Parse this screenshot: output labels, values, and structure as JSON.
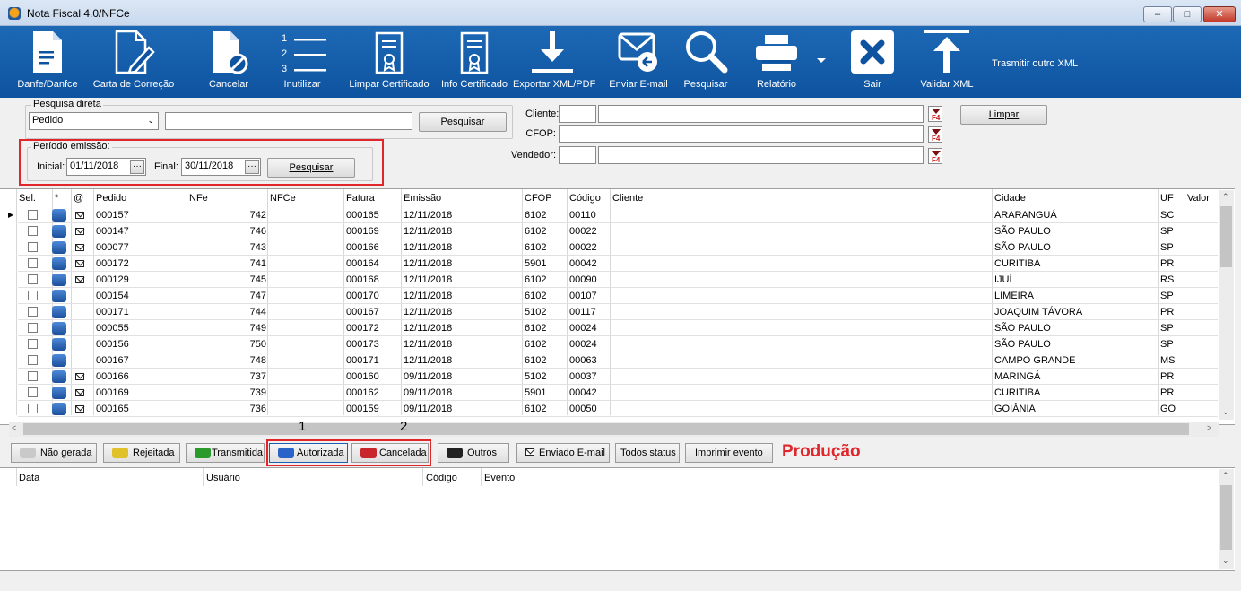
{
  "window": {
    "title": "Nota Fiscal 4.0/NFCe",
    "min_glyph": "–",
    "max_glyph": "□",
    "close_glyph": "✕"
  },
  "toolbar": {
    "items": [
      {
        "label": "Danfe/Danfce",
        "icon": "document-icon"
      },
      {
        "label": "Carta de Correção",
        "icon": "pencil-document-icon"
      },
      {
        "label": "Cancelar",
        "icon": "cancel-document-icon"
      },
      {
        "label": "Inutilizar",
        "icon": "numbered-list-icon"
      },
      {
        "label": "Limpar Certificado",
        "icon": "certificate-icon"
      },
      {
        "label": "Info Certificado",
        "icon": "certificate-info-icon"
      },
      {
        "label": "Exportar XML/PDF",
        "icon": "download-icon"
      },
      {
        "label": "Enviar E-mail",
        "icon": "mail-reply-icon"
      },
      {
        "label": "Pesquisar",
        "icon": "search-icon"
      },
      {
        "label": "Relatório",
        "icon": "printer-icon"
      },
      {
        "label": "Sair",
        "icon": "close-icon"
      },
      {
        "label": "Validar XML",
        "icon": "upload-arrow-icon"
      }
    ],
    "list_numbers": [
      "1",
      "2",
      "3"
    ],
    "transmit_other": "Trasmitir outro XML"
  },
  "search": {
    "group_title": "Pesquisa direta",
    "type_value": "Pedido",
    "text_value": "",
    "button": "Pesquisar"
  },
  "period": {
    "group_title": "Período emissão:",
    "start_label": "Inicial:",
    "start_value": "01/11/2018",
    "end_label": "Final:",
    "end_value": "30/11/2018",
    "button": "Pesquisar",
    "ellipsis": "···"
  },
  "filters": {
    "cliente_label": "Cliente:",
    "cfop_label": "CFOP:",
    "vendedor_label": "Vendedor:",
    "f4": "F4",
    "clear_button": "Limpar"
  },
  "grid": {
    "columns": [
      "Sel.",
      "*",
      "@",
      "Pedido",
      "NFe",
      "NFCe",
      "Fatura",
      "Emissão",
      "CFOP",
      "Código",
      "Cliente",
      "Cidade",
      "UF",
      "Valor"
    ],
    "current_row_marker": "▶",
    "rows": [
      {
        "pedido": "000157",
        "nfe": "742",
        "nfce": "",
        "fatura": "000165",
        "emissao": "12/11/2018",
        "cfop": "6102",
        "codigo": "00110",
        "cliente": "",
        "cidade": "ARARANGUÁ",
        "uf": "SC",
        "mail": true
      },
      {
        "pedido": "000147",
        "nfe": "746",
        "nfce": "",
        "fatura": "000169",
        "emissao": "12/11/2018",
        "cfop": "6102",
        "codigo": "00022",
        "cliente": "",
        "cidade": "SÃO PAULO",
        "uf": "SP",
        "mail": true
      },
      {
        "pedido": "000077",
        "nfe": "743",
        "nfce": "",
        "fatura": "000166",
        "emissao": "12/11/2018",
        "cfop": "6102",
        "codigo": "00022",
        "cliente": "",
        "cidade": "SÃO PAULO",
        "uf": "SP",
        "mail": true
      },
      {
        "pedido": "000172",
        "nfe": "741",
        "nfce": "",
        "fatura": "000164",
        "emissao": "12/11/2018",
        "cfop": "5901",
        "codigo": "00042",
        "cliente": "",
        "cidade": "CURITIBA",
        "uf": "PR",
        "mail": true
      },
      {
        "pedido": "000129",
        "nfe": "745",
        "nfce": "",
        "fatura": "000168",
        "emissao": "12/11/2018",
        "cfop": "6102",
        "codigo": "00090",
        "cliente": "",
        "cidade": "IJUÍ",
        "uf": "RS",
        "mail": true
      },
      {
        "pedido": "000154",
        "nfe": "747",
        "nfce": "",
        "fatura": "000170",
        "emissao": "12/11/2018",
        "cfop": "6102",
        "codigo": "00107",
        "cliente": "",
        "cidade": "LIMEIRA",
        "uf": "SP",
        "mail": false
      },
      {
        "pedido": "000171",
        "nfe": "744",
        "nfce": "",
        "fatura": "000167",
        "emissao": "12/11/2018",
        "cfop": "5102",
        "codigo": "00117",
        "cliente": "",
        "cidade": "JOAQUIM TÁVORA",
        "uf": "PR",
        "mail": false
      },
      {
        "pedido": "000055",
        "nfe": "749",
        "nfce": "",
        "fatura": "000172",
        "emissao": "12/11/2018",
        "cfop": "6102",
        "codigo": "00024",
        "cliente": "",
        "cidade": "SÃO PAULO",
        "uf": "SP",
        "mail": false
      },
      {
        "pedido": "000156",
        "nfe": "750",
        "nfce": "",
        "fatura": "000173",
        "emissao": "12/11/2018",
        "cfop": "6102",
        "codigo": "00024",
        "cliente": "",
        "cidade": "SÃO PAULO",
        "uf": "SP",
        "mail": false
      },
      {
        "pedido": "000167",
        "nfe": "748",
        "nfce": "",
        "fatura": "000171",
        "emissao": "12/11/2018",
        "cfop": "6102",
        "codigo": "00063",
        "cliente": "",
        "cidade": "CAMPO GRANDE",
        "uf": "MS",
        "mail": false
      },
      {
        "pedido": "000166",
        "nfe": "737",
        "nfce": "",
        "fatura": "000160",
        "emissao": "09/11/2018",
        "cfop": "5102",
        "codigo": "00037",
        "cliente": "",
        "cidade": "MARINGÁ",
        "uf": "PR",
        "mail": true
      },
      {
        "pedido": "000169",
        "nfe": "739",
        "nfce": "",
        "fatura": "000162",
        "emissao": "09/11/2018",
        "cfop": "5901",
        "codigo": "00042",
        "cliente": "",
        "cidade": "CURITIBA",
        "uf": "PR",
        "mail": true
      },
      {
        "pedido": "000165",
        "nfe": "736",
        "nfce": "",
        "fatura": "000159",
        "emissao": "09/11/2018",
        "cfop": "6102",
        "codigo": "00050",
        "cliente": "",
        "cidade": "GOIÂNIA",
        "uf": "GO",
        "mail": true
      }
    ]
  },
  "annotations": {
    "one": "1",
    "two": "2"
  },
  "status_buttons": [
    {
      "label": "Não gerada",
      "color": "#c9c9c9"
    },
    {
      "label": "Rejeitada",
      "color": "#e0c12a"
    },
    {
      "label": "Transmitida",
      "color": "#2a9a2a"
    },
    {
      "label": "Autorizada",
      "color": "#2a63c8"
    },
    {
      "label": "Cancelada",
      "color": "#c8262a"
    },
    {
      "label": "Outros",
      "color": "#222222"
    }
  ],
  "extra_buttons": {
    "email_sent": "Enviado E-mail",
    "all_status": "Todos status",
    "print_event": "Imprimir evento"
  },
  "environment": "Produção",
  "events_grid": {
    "columns": [
      "Data",
      "Usuário",
      "Código",
      "Evento"
    ]
  },
  "colors": {
    "toolbar": "#0e53a0",
    "highlight": "#e0262a",
    "environment_text": "#e0262a"
  }
}
